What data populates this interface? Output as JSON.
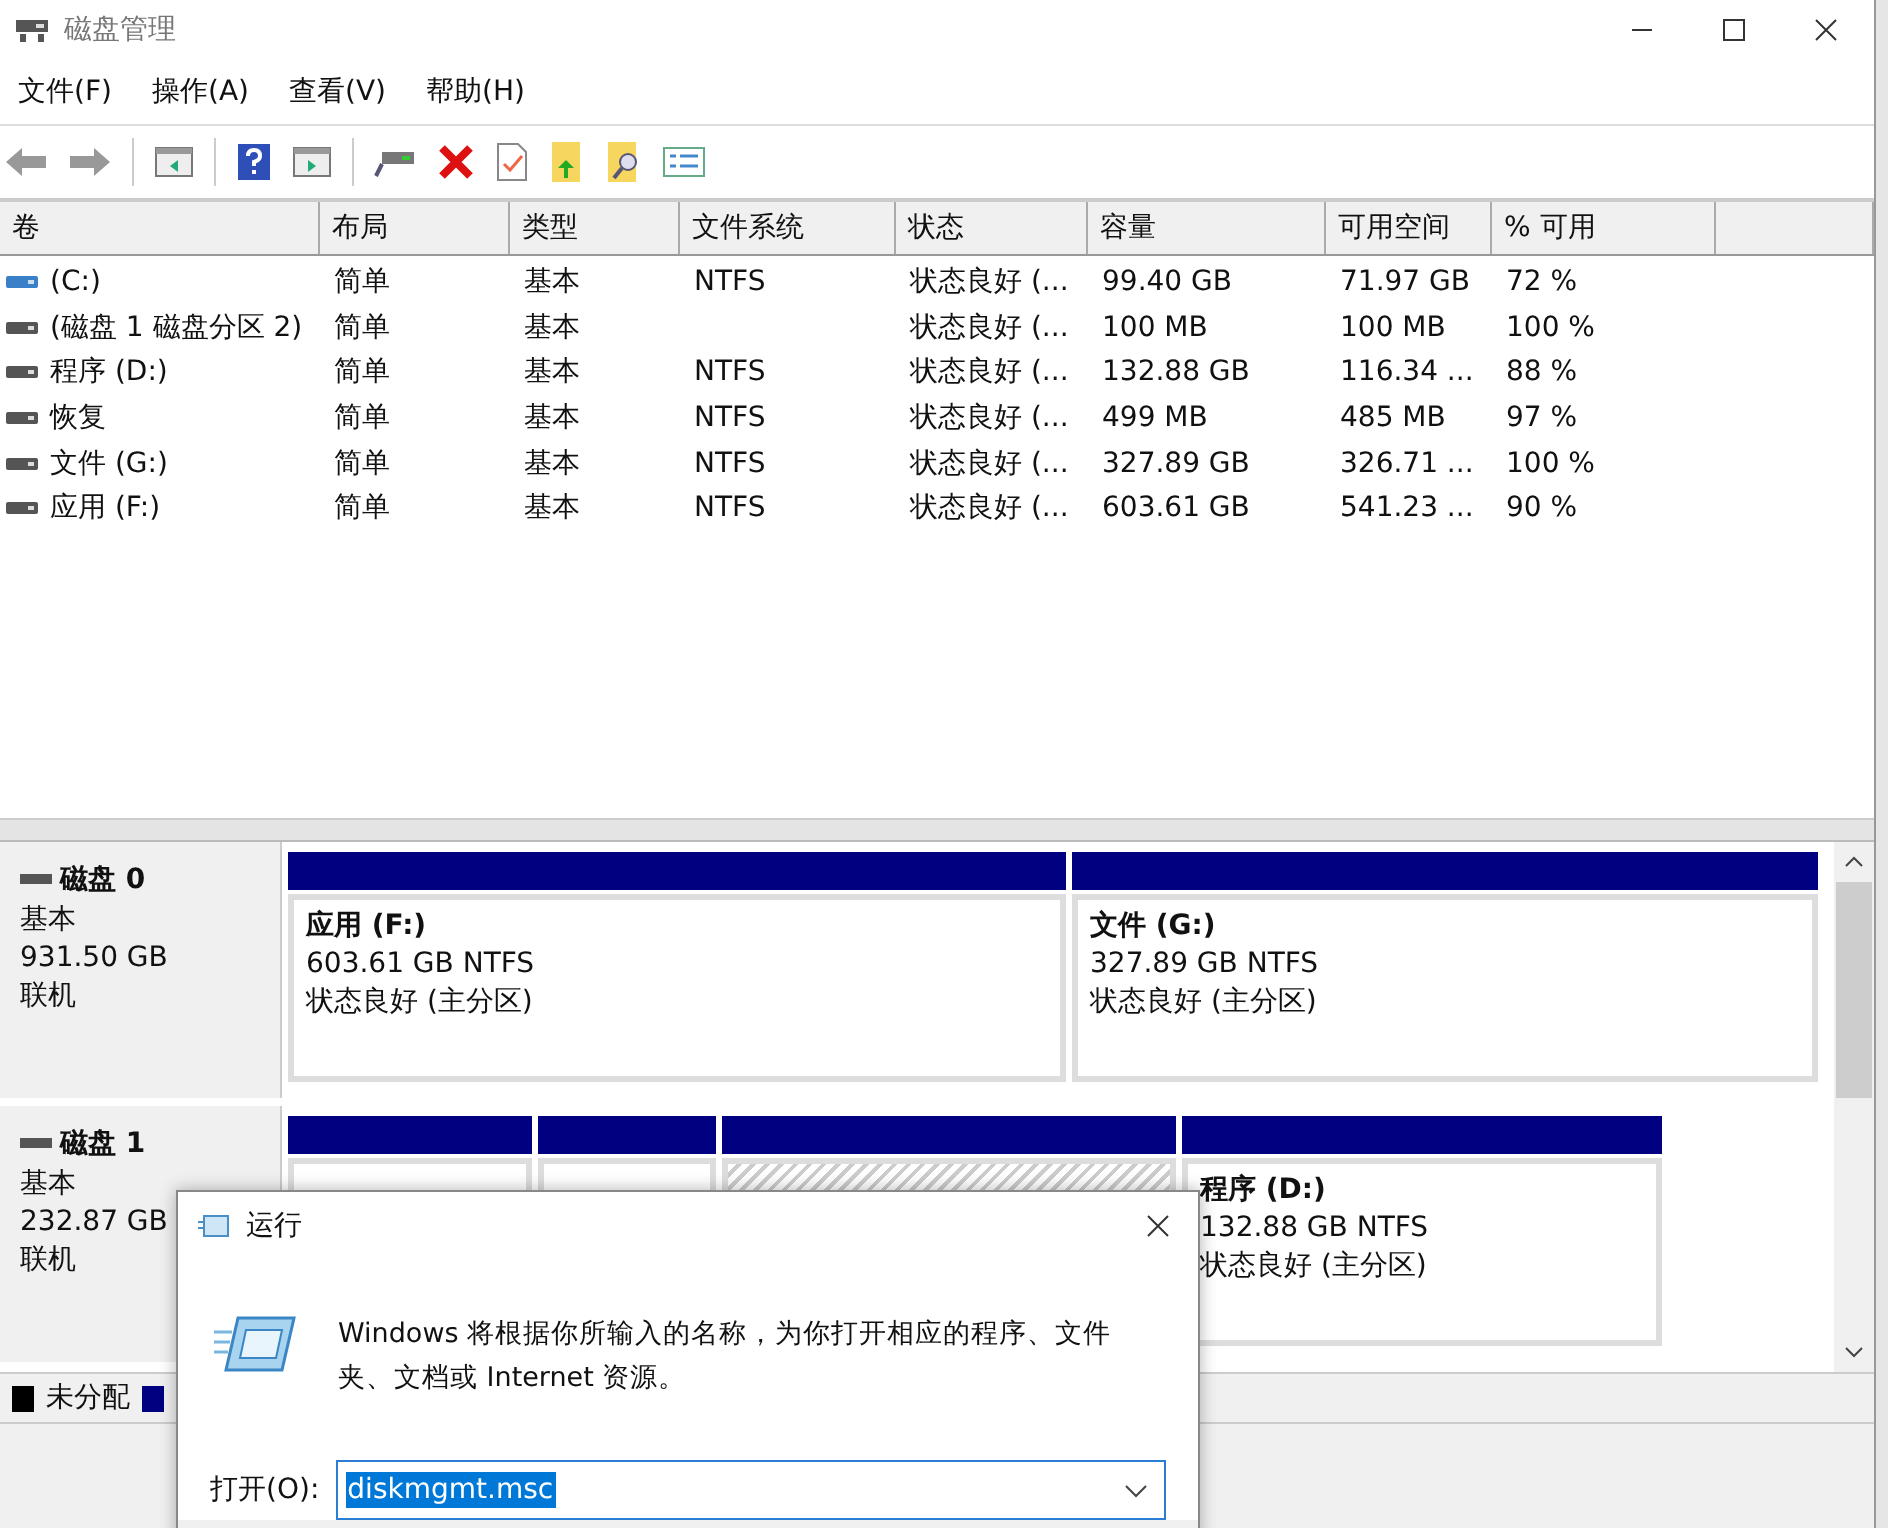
{
  "window": {
    "title": "磁盘管理"
  },
  "menu": [
    "文件(F)",
    "操作(A)",
    "查看(V)",
    "帮助(H)"
  ],
  "table": {
    "columns": [
      "卷",
      "布局",
      "类型",
      "文件系统",
      "状态",
      "容量",
      "可用空间",
      "% 可用"
    ],
    "rows": [
      {
        "kind": "system",
        "cells": [
          "(C:)",
          "简单",
          "基本",
          "NTFS",
          "状态良好 (...",
          "99.40 GB",
          "71.97 GB",
          "72 %"
        ]
      },
      {
        "kind": "volume",
        "cells": [
          "(磁盘 1 磁盘分区 2)",
          "简单",
          "基本",
          "",
          "状态良好 (...",
          "100 MB",
          "100 MB",
          "100 %"
        ]
      },
      {
        "kind": "volume",
        "cells": [
          "程序 (D:)",
          "简单",
          "基本",
          "NTFS",
          "状态良好 (...",
          "132.88 GB",
          "116.34 ...",
          "88 %"
        ]
      },
      {
        "kind": "volume",
        "cells": [
          "恢复",
          "简单",
          "基本",
          "NTFS",
          "状态良好 (...",
          "499 MB",
          "485 MB",
          "97 %"
        ]
      },
      {
        "kind": "volume",
        "cells": [
          "文件 (G:)",
          "简单",
          "基本",
          "NTFS",
          "状态良好 (...",
          "327.89 GB",
          "326.71 ...",
          "100 %"
        ]
      },
      {
        "kind": "volume",
        "cells": [
          "应用 (F:)",
          "简单",
          "基本",
          "NTFS",
          "状态良好 (...",
          "603.61 GB",
          "541.23 ...",
          "90 %"
        ]
      }
    ]
  },
  "disks": [
    {
      "name": "磁盘 0",
      "type": "基本",
      "size": "931.50 GB",
      "status": "联机",
      "partitions": [
        {
          "label": "应用  (F:)",
          "detail": "603.61 GB NTFS",
          "status": "状态良好 (主分区)",
          "selected": false
        },
        {
          "label": "文件  (G:)",
          "detail": "327.89 GB NTFS",
          "status": "状态良好 (主分区)",
          "selected": false
        }
      ]
    },
    {
      "name": "磁盘 1",
      "type": "基本",
      "size": "232.87 GB",
      "status": "联机",
      "partitions": [
        {
          "selected": false
        },
        {
          "selected": false
        },
        {
          "selected": true
        },
        {
          "label": "程序  (D:)",
          "detail": "132.88 GB NTFS",
          "status": "状态良好 (主分区)",
          "selected": false
        }
      ]
    }
  ],
  "legend": [
    {
      "label": "未分配",
      "color": "#000000"
    },
    {
      "color": "#000080"
    }
  ],
  "dialog": {
    "title": "运行",
    "message": "Windows 将根据你所输入的名称，为你打开相应的程序、文件夹、文档或 Internet 资源。",
    "open_label": "打开(O):",
    "value": "diskmgmt.msc"
  }
}
